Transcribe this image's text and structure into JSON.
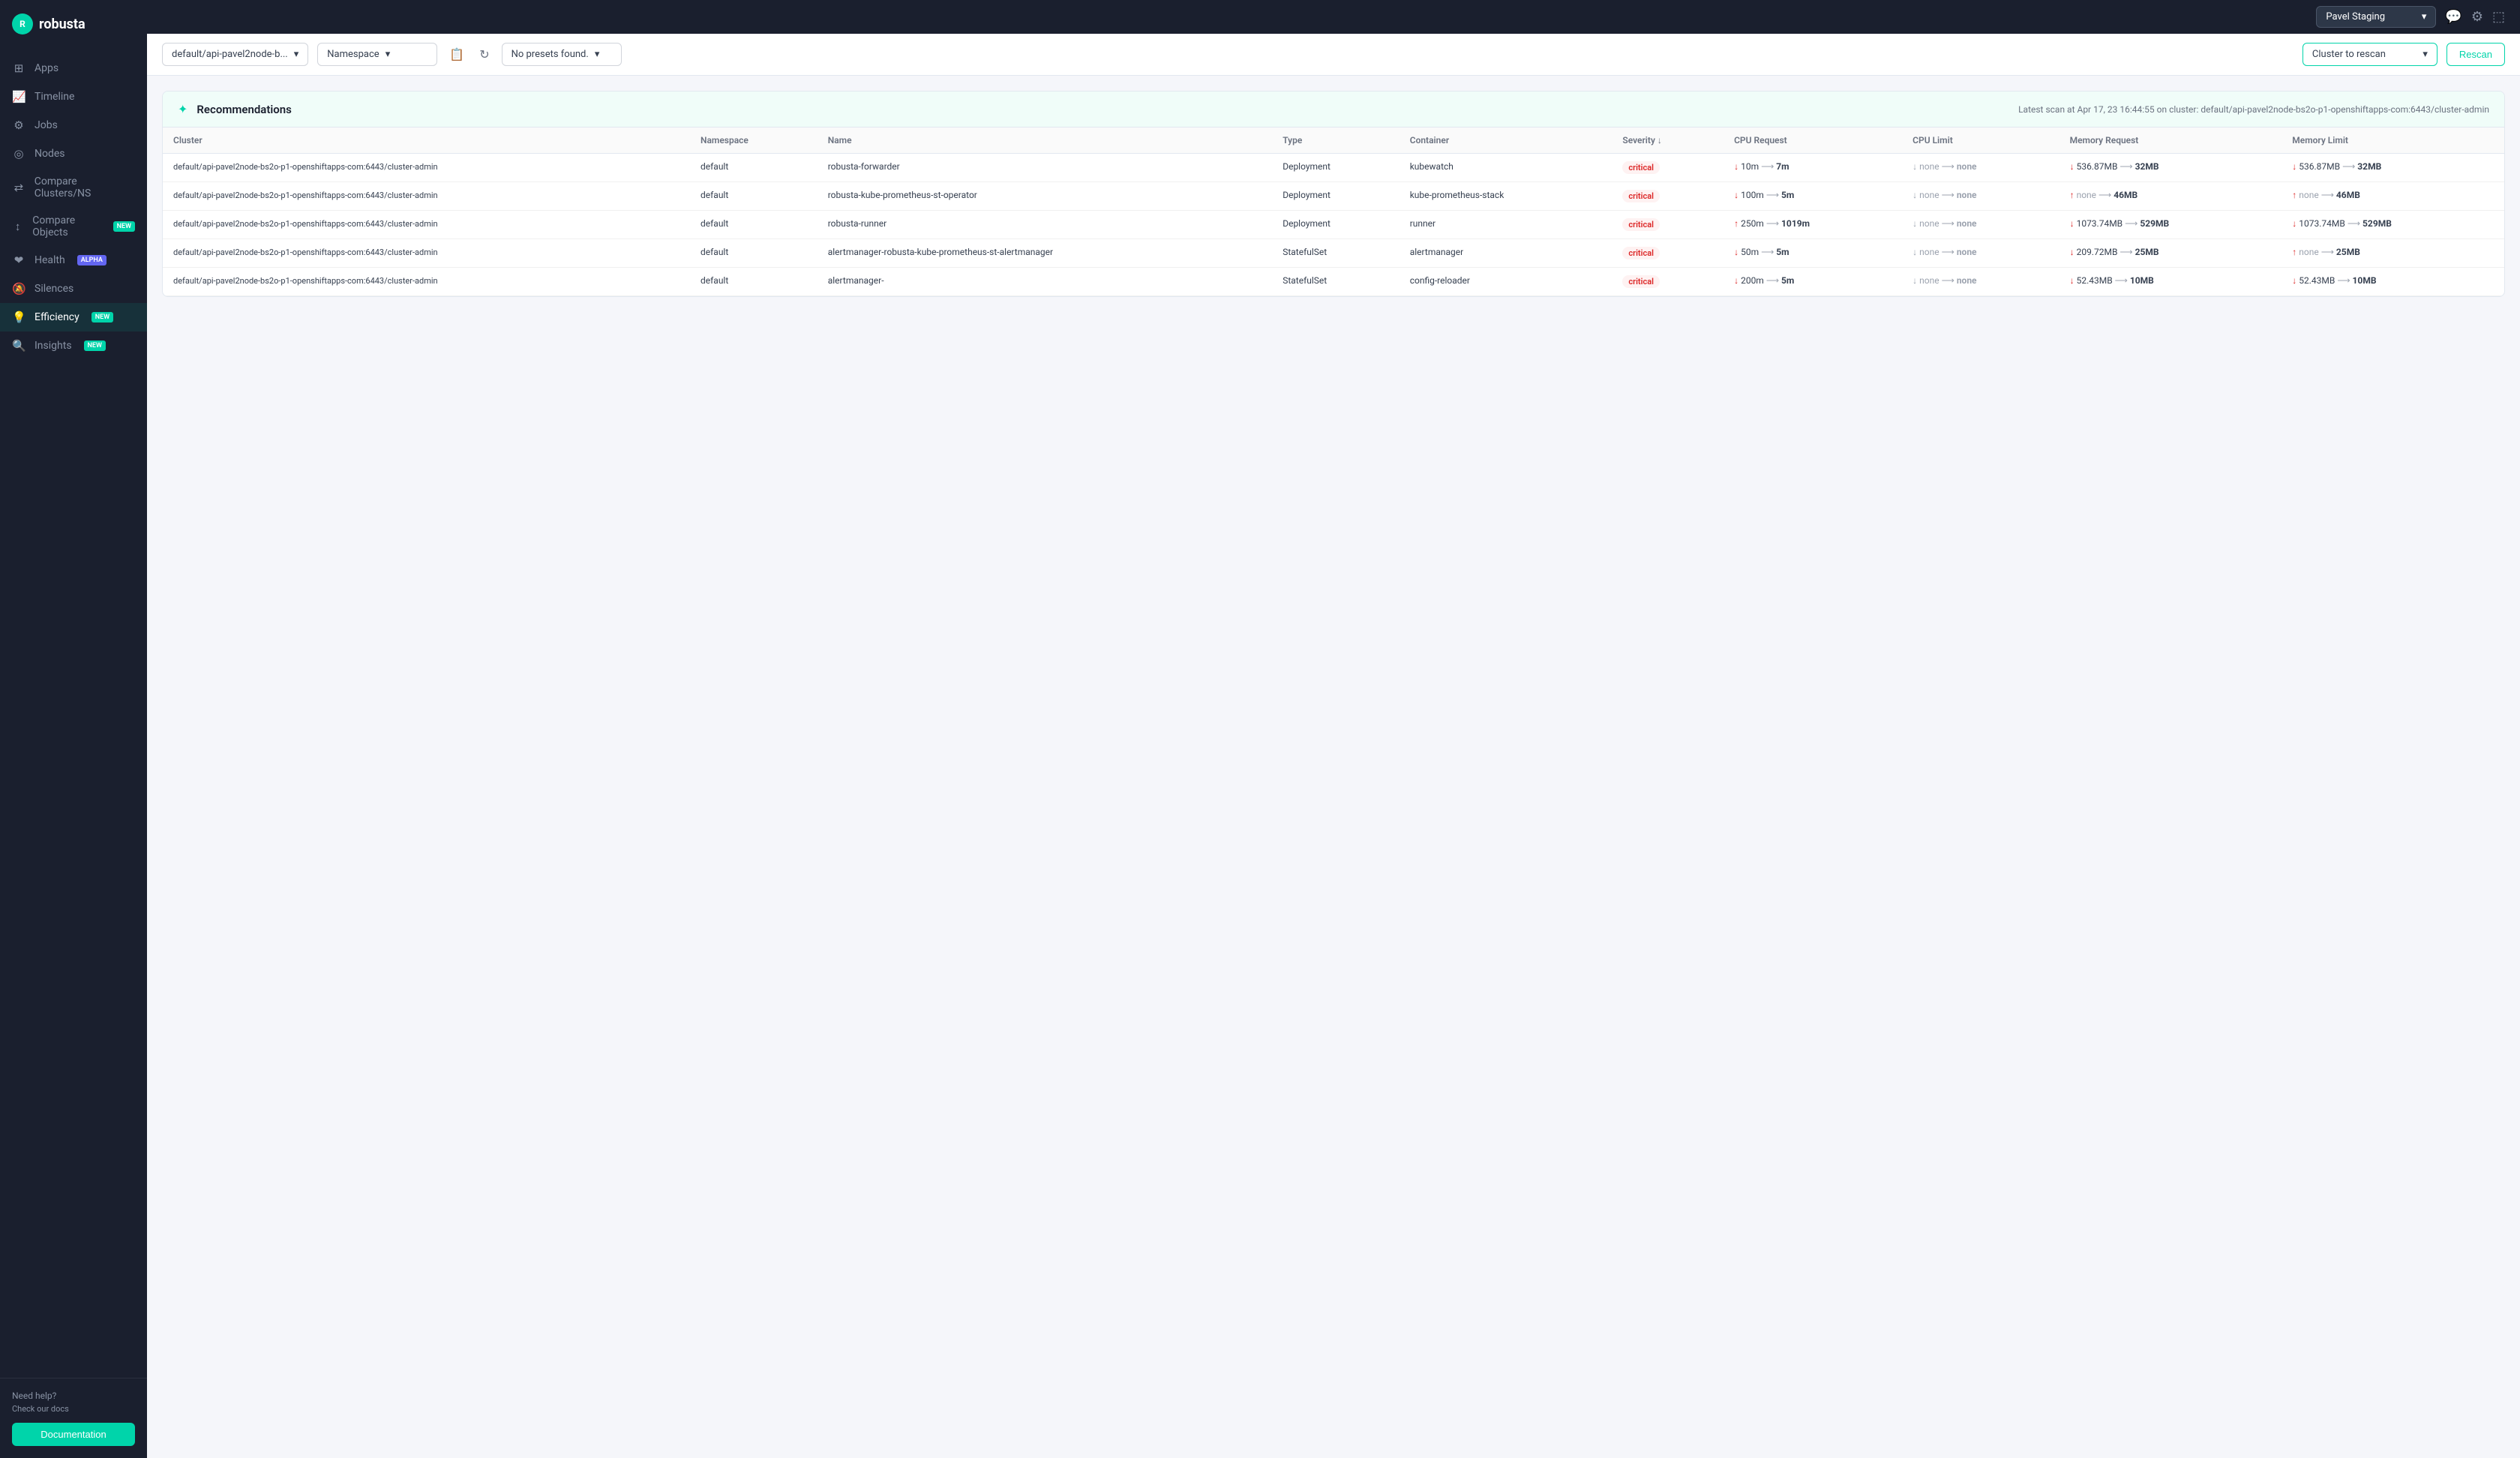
{
  "app": {
    "logo_text": "robusta",
    "cluster_selector_label": "Pavel Staging"
  },
  "sidebar": {
    "items": [
      {
        "id": "apps",
        "label": "Apps",
        "icon": "⊞",
        "active": false,
        "badge": null
      },
      {
        "id": "timeline",
        "label": "Timeline",
        "icon": "📈",
        "active": false,
        "badge": null
      },
      {
        "id": "jobs",
        "label": "Jobs",
        "icon": "⚙",
        "active": false,
        "badge": null
      },
      {
        "id": "nodes",
        "label": "Nodes",
        "icon": "◎",
        "active": false,
        "badge": null
      },
      {
        "id": "compare-clusters",
        "label": "Compare Clusters/NS",
        "icon": "⇄",
        "active": false,
        "badge": null
      },
      {
        "id": "compare-objects",
        "label": "Compare Objects",
        "icon": "↕",
        "active": false,
        "badge": "NEW"
      },
      {
        "id": "health",
        "label": "Health",
        "icon": "❤",
        "active": false,
        "badge": "ALPHA"
      },
      {
        "id": "silences",
        "label": "Silences",
        "icon": "🔕",
        "active": false,
        "badge": null
      },
      {
        "id": "efficiency",
        "label": "Efficiency",
        "icon": "💡",
        "active": true,
        "badge": "NEW"
      },
      {
        "id": "insights",
        "label": "Insights",
        "icon": "🔍",
        "active": false,
        "badge": "NEW"
      }
    ],
    "help": {
      "title": "Need help?",
      "subtitle": "Check our docs",
      "button_label": "Documentation"
    }
  },
  "toolbar": {
    "cluster_value": "default/api-pavel2node-b...",
    "namespace_label": "Namespace",
    "preset_placeholder": "No presets found.",
    "cluster_rescan_label": "Cluster to rescan",
    "rescan_button": "Rescan"
  },
  "panel": {
    "title": "Recommendations",
    "subtitle": "Latest scan at Apr 17, 23 16:44:55 on cluster: default/api-pavel2node-bs2o-p1-openshiftapps-com:6443/cluster-admin"
  },
  "table": {
    "columns": [
      "Cluster",
      "Namespace",
      "Name",
      "Type",
      "Container",
      "Severity",
      "CPU Request",
      "CPU Limit",
      "Memory Request",
      "Memory Limit"
    ],
    "rows": [
      {
        "cluster": "default/api-pavel2node-bs2o-p1-openshiftapps-com:6443/cluster-admin",
        "namespace": "default",
        "name": "robusta-forwarder",
        "type": "Deployment",
        "container": "kubewatch",
        "severity": "critical",
        "cpu_request": {
          "dir": "down",
          "from": "10m",
          "to": "7m"
        },
        "cpu_limit": {
          "dir": "none",
          "from": "none",
          "to": "none"
        },
        "memory_request": {
          "dir": "down",
          "from": "536.87MB",
          "to": "32MB"
        },
        "memory_limit": {
          "dir": "down",
          "from": "536.87MB",
          "to": "32MB"
        }
      },
      {
        "cluster": "default/api-pavel2node-bs2o-p1-openshiftapps-com:6443/cluster-admin",
        "namespace": "default",
        "name": "robusta-kube-prometheus-st-operator",
        "type": "Deployment",
        "container": "kube-prometheus-stack",
        "severity": "critical",
        "cpu_request": {
          "dir": "down",
          "from": "100m",
          "to": "5m"
        },
        "cpu_limit": {
          "dir": "none",
          "from": "none",
          "to": "none"
        },
        "memory_request": {
          "dir": "none_up",
          "from": "none",
          "to": "46MB"
        },
        "memory_limit": {
          "dir": "up",
          "from": "none",
          "to": "46MB"
        }
      },
      {
        "cluster": "default/api-pavel2node-bs2o-p1-openshiftapps-com:6443/cluster-admin",
        "namespace": "default",
        "name": "robusta-runner",
        "type": "Deployment",
        "container": "runner",
        "severity": "critical",
        "cpu_request": {
          "dir": "up",
          "from": "250m",
          "to": "1019m"
        },
        "cpu_limit": {
          "dir": "none",
          "from": "none",
          "to": "none"
        },
        "memory_request": {
          "dir": "down",
          "from": "1073.74MB",
          "to": "529MB"
        },
        "memory_limit": {
          "dir": "down",
          "from": "1073.74MB",
          "to": "529MB"
        }
      },
      {
        "cluster": "default/api-pavel2node-bs2o-p1-openshiftapps-com:6443/cluster-admin",
        "namespace": "default",
        "name": "alertmanager-robusta-kube-prometheus-st-alertmanager",
        "type": "StatefulSet",
        "container": "alertmanager",
        "severity": "critical",
        "cpu_request": {
          "dir": "down",
          "from": "50m",
          "to": "5m"
        },
        "cpu_limit": {
          "dir": "none",
          "from": "none",
          "to": "none"
        },
        "memory_request": {
          "dir": "down",
          "from": "209.72MB",
          "to": "25MB"
        },
        "memory_limit": {
          "dir": "up",
          "from": "none",
          "to": "25MB"
        }
      },
      {
        "cluster": "default/api-pavel2node-bs2o-p1-openshiftapps-com:6443/cluster-admin",
        "namespace": "default",
        "name": "alertmanager-",
        "type": "StatefulSet",
        "container": "config-reloader",
        "severity": "critical",
        "cpu_request": {
          "dir": "down",
          "from": "200m",
          "to": "5m"
        },
        "cpu_limit": {
          "dir": "none",
          "from": "none",
          "to": "none"
        },
        "memory_request": {
          "dir": "down",
          "from": "52.43MB",
          "to": "10MB"
        },
        "memory_limit": {
          "dir": "down",
          "from": "52.43MB",
          "to": "10MB"
        }
      }
    ]
  }
}
